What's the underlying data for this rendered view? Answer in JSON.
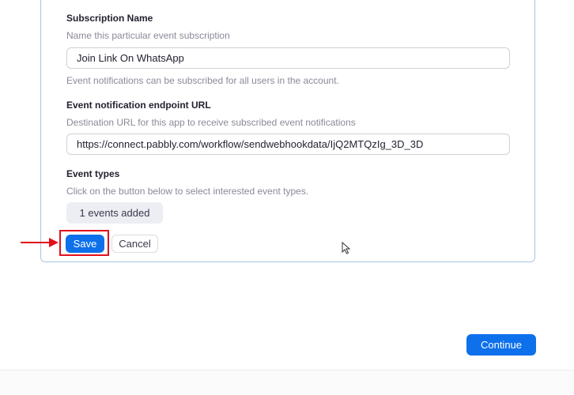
{
  "subscription": {
    "name_label": "Subscription Name",
    "name_hint": "Name this particular event subscription",
    "name_value": "Join Link On WhatsApp",
    "name_note": "Event notifications can be subscribed for all users in the account."
  },
  "endpoint": {
    "label": "Event notification endpoint URL",
    "hint": "Destination URL for this app to receive subscribed event notifications",
    "value": "https://connect.pabbly.com/workflow/sendwebhookdata/IjQ2MTQzIg_3D_3D"
  },
  "event_types": {
    "label": "Event types",
    "hint": "Click on the button below to select interested event types.",
    "added_label": "1 events added"
  },
  "actions": {
    "save_label": "Save",
    "cancel_label": "Cancel",
    "continue_label": "Continue"
  },
  "annotation": {
    "highlight_color": "#e3101a",
    "arrow_icon": "red-arrow-right-icon"
  },
  "colors": {
    "primary": "#0e71eb",
    "card_border": "#a9c6e3"
  }
}
